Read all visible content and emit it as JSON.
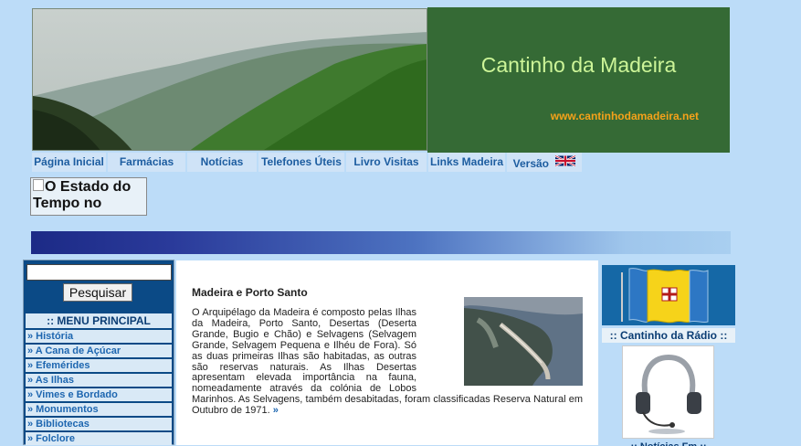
{
  "header": {
    "title": "Cantinho da Madeira",
    "url": "www.cantinhodamadeira.net"
  },
  "nav": [
    {
      "label": "Página Inicial"
    },
    {
      "label": "Farmácias"
    },
    {
      "label": "Notícias"
    },
    {
      "label": "Telefones Úteis"
    },
    {
      "label": "Livro Visitas"
    },
    {
      "label": "Links Madeira"
    },
    {
      "label": "Versão"
    }
  ],
  "weather": {
    "alt_text": "O Estado do Tempo no"
  },
  "search": {
    "button_label": "Pesquisar",
    "value": ""
  },
  "menu": {
    "heading": ":: MENU PRINCIPAL",
    "items": [
      "» História",
      "» A Cana de Açúcar",
      "» Efemérides",
      "» As Ilhas",
      "» Vimes e Bordado",
      "» Monumentos",
      "» Bibliotecas",
      "» Folclore"
    ]
  },
  "article": {
    "title": "Madeira e Porto Santo",
    "body": "O Arquipélago da Madeira é composto pelas Ilhas da Madeira, Porto Santo, Desertas (Deserta Grande, Bugio e Chão) e Selvagens (Selvagem Grande, Selvagem Pequena e Ilhéu de Fora). Só as duas primeiras Ilhas são habitadas, as outras são reservas naturais. As Ilhas Desertas apresentam elevada importância na fauna, nomeadamente através da colónia de Lobos Marinhos. As Selvagens, também desabitadas, foram classificadas Reserva Natural em Outubro de 1971.",
    "more": "»"
  },
  "right_sidebar": {
    "radio_heading": ":: Cantinho da Rádio ::",
    "news_heading": ":: Notícias Fm ::"
  },
  "colors": {
    "header_green": "#356a35",
    "title_green": "#cdf598",
    "url_orange": "#f5a21a",
    "page_bg": "#bcdcf8",
    "nav_text": "#1d5da0",
    "menu_bg": "#0b4a86"
  }
}
